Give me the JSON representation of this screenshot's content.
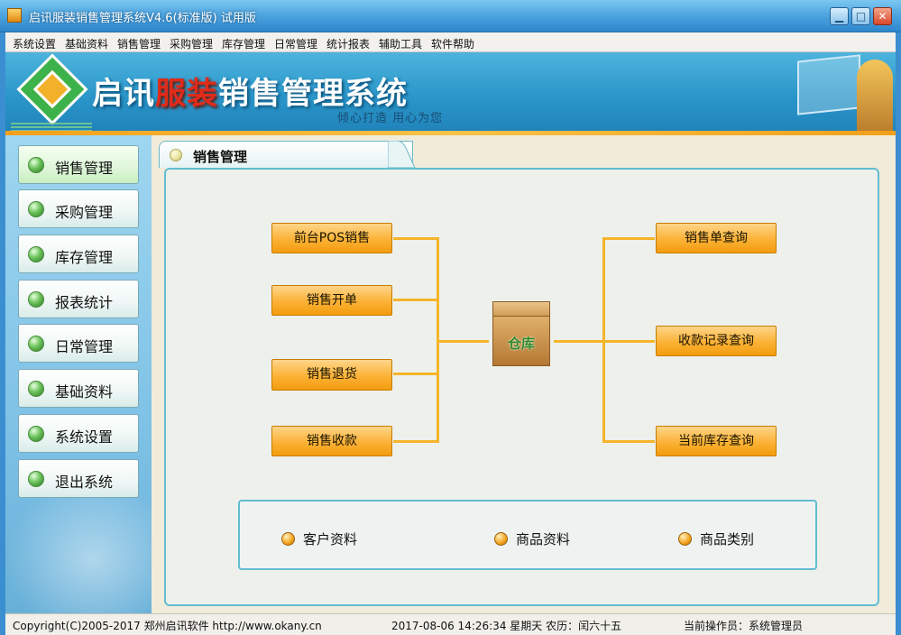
{
  "window": {
    "title": "启讯服装销售管理系统V4.6(标准版)  试用版",
    "controls": {
      "minimize": "▁",
      "maximize": "□",
      "close": "✕"
    }
  },
  "menubar": [
    "系统设置",
    "基础资料",
    "销售管理",
    "采购管理",
    "库存管理",
    "日常管理",
    "统计报表",
    "辅助工具",
    "软件帮助"
  ],
  "banner": {
    "title_pre": "启讯",
    "title_highlight": "服装",
    "title_post": "销售管理系统",
    "slogan": "倾心打造  用心为您",
    "highlight_color": "#e02b1a"
  },
  "sidebar": {
    "items": [
      {
        "label": "销售管理",
        "icon": "green-dot-icon",
        "active": true
      },
      {
        "label": "采购管理",
        "icon": "green-dot-icon"
      },
      {
        "label": "库存管理",
        "icon": "green-dot-icon"
      },
      {
        "label": "报表统计",
        "icon": "green-dot-icon"
      },
      {
        "label": "日常管理",
        "icon": "green-dot-icon"
      },
      {
        "label": "基础资料",
        "icon": "green-dot-icon"
      },
      {
        "label": "系统设置",
        "icon": "green-dot-icon"
      },
      {
        "label": "退出系统",
        "icon": "green-dot-icon"
      }
    ]
  },
  "main": {
    "tab_label": "销售管理",
    "left_buttons": [
      "前台POS销售",
      "销售开单",
      "销售退货",
      "销售收款"
    ],
    "right_buttons": [
      "销售单查询",
      "收款记录查询",
      "当前库存查询"
    ],
    "center_box_label": "仓库",
    "quick_links": [
      "客户资料",
      "商品资料",
      "商品类别"
    ],
    "accent_color": "#f39c0d"
  },
  "statusbar": {
    "copyright": "Copyright(C)2005-2017  郑州启讯软件  http://www.okany.cn",
    "datetime": "2017-08-06 14:26:34 星期天  农历：闰六十五",
    "operator": "当前操作员：系统管理员"
  }
}
